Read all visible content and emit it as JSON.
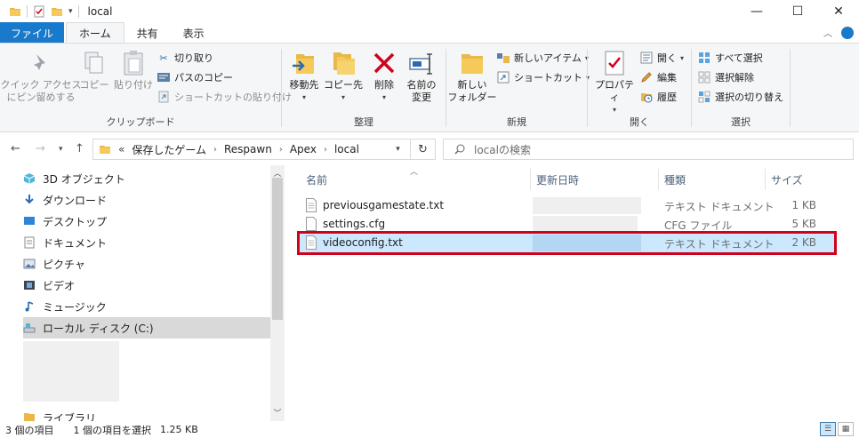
{
  "titlebar": {
    "title": "local",
    "minimize": "—",
    "maximize": "☐",
    "close": "✕"
  },
  "ribbon_tabs": {
    "file": "ファイル",
    "home": "ホーム",
    "share": "共有",
    "view": "表示"
  },
  "ribbon": {
    "clipboard": {
      "label": "クリップボード",
      "pin": "クイック アクセス\nにピン留めする",
      "copy": "コピー",
      "paste": "貼り付け",
      "cut": "切り取り",
      "copy_path": "パスのコピー",
      "paste_shortcut": "ショートカットの貼り付け"
    },
    "organize": {
      "label": "整理",
      "move_to": "移動先",
      "copy_to": "コピー先",
      "delete": "削除",
      "rename": "名前の\n変更"
    },
    "new": {
      "label": "新規",
      "new_folder": "新しい\nフォルダー",
      "new_item": "新しいアイテム",
      "shortcut": "ショートカット"
    },
    "open": {
      "label": "開く",
      "properties": "プロパティ",
      "open": "開く",
      "edit": "編集",
      "history": "履歴"
    },
    "select": {
      "label": "選択",
      "select_all": "すべて選択",
      "select_none": "選択解除",
      "invert": "選択の切り替え"
    }
  },
  "address": {
    "prefix": "«",
    "crumbs": [
      "保存したゲーム",
      "Respawn",
      "Apex",
      "local"
    ],
    "search_placeholder": "localの検索"
  },
  "nav": {
    "items": [
      {
        "label": "3D オブジェクト",
        "icon": "3d-objects-icon"
      },
      {
        "label": "ダウンロード",
        "icon": "download-icon"
      },
      {
        "label": "デスクトップ",
        "icon": "desktop-icon"
      },
      {
        "label": "ドキュメント",
        "icon": "documents-icon"
      },
      {
        "label": "ピクチャ",
        "icon": "pictures-icon"
      },
      {
        "label": "ビデオ",
        "icon": "videos-icon"
      },
      {
        "label": "ミュージック",
        "icon": "music-icon"
      },
      {
        "label": "ローカル ディスク (C:)",
        "icon": "drive-icon"
      }
    ],
    "partial_item": "ライブラリ"
  },
  "columns": {
    "name": "名前",
    "date": "更新日時",
    "type": "種類",
    "size": "サイズ"
  },
  "files": [
    {
      "name": "previousgamestate.txt",
      "type": "テキスト ドキュメント",
      "size": "1 KB"
    },
    {
      "name": "settings.cfg",
      "type": "CFG ファイル",
      "size": "5 KB"
    },
    {
      "name": "videoconfig.txt",
      "type": "テキスト ドキュメント",
      "size": "2 KB"
    }
  ],
  "status": {
    "count": "3 個の項目",
    "selected": "1 個の項目を選択",
    "size": "1.25 KB"
  },
  "colors": {
    "file_tab": "#1979ca",
    "selection": "#cce8ff",
    "highlight": "#d0021b"
  }
}
